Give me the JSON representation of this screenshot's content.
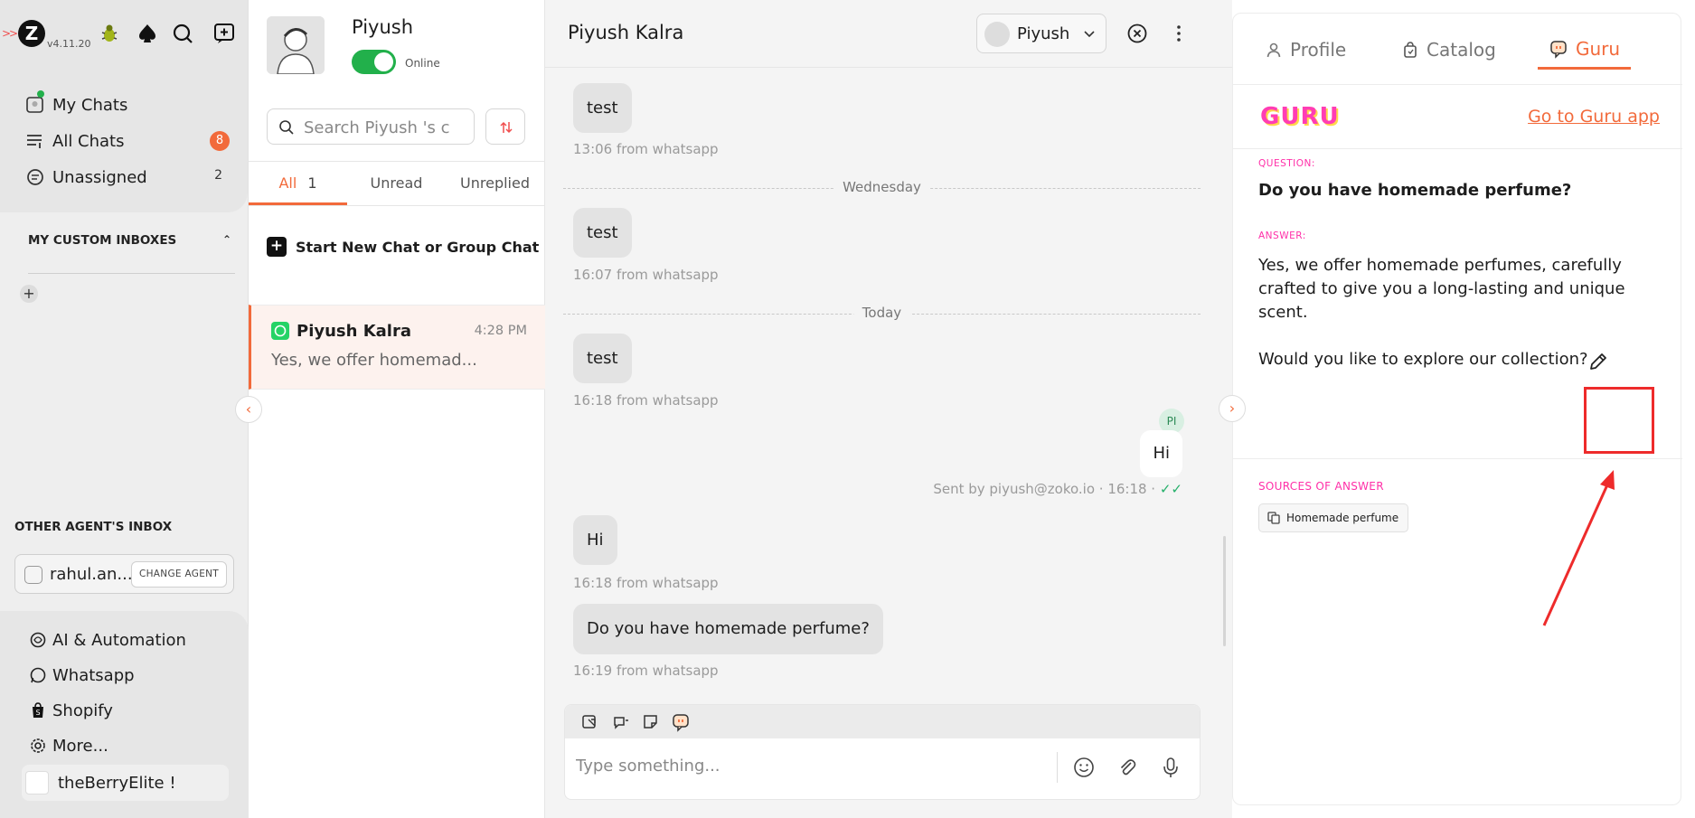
{
  "sidebar": {
    "version": "v4.11.20",
    "logo_letter": "Z",
    "nav": [
      {
        "label": "My Chats"
      },
      {
        "label": "All Chats",
        "badge": "8"
      },
      {
        "label": "Unassigned",
        "count": "2"
      }
    ],
    "custom_inboxes_title": "MY CUSTOM INBOXES",
    "other_agents_title": "OTHER AGENT'S INBOX",
    "agent_name": "rahul.an...",
    "change_agent_label": "CHANGE AGENT",
    "bottom_nav": [
      {
        "label": "AI & Automation"
      },
      {
        "label": "Whatsapp"
      },
      {
        "label": "Shopify"
      },
      {
        "label": "More..."
      }
    ],
    "store_name": "theBerryElite !"
  },
  "chatlist": {
    "user_name": "Piyush",
    "status": "Online",
    "search_placeholder": "Search Piyush 's c",
    "tabs": [
      {
        "label": "All",
        "count": "1"
      },
      {
        "label": "Unread"
      },
      {
        "label": "Unreplied"
      }
    ],
    "new_chat_label": "Start New Chat or Group Chat",
    "chats": [
      {
        "name": "Piyush Kalra",
        "time": "4:28 PM",
        "preview": "Yes, we offer homemad..."
      }
    ]
  },
  "conversation": {
    "title": "Piyush Kalra",
    "assignee": "Piyush",
    "messages": [
      {
        "text": "test",
        "meta": "13:06 from whatsapp"
      },
      {
        "divider": "Wednesday"
      },
      {
        "text": "test",
        "meta": "16:07 from whatsapp"
      },
      {
        "divider": "Today"
      },
      {
        "text": "test",
        "meta": "16:18 from whatsapp"
      },
      {
        "out_text": "Hi",
        "out_avatar": "PI",
        "out_meta": "Sent by piyush@zoko.io · 16:18 ·",
        "ticks": "✓✓"
      },
      {
        "text": "Hi",
        "meta": "16:18 from whatsapp"
      },
      {
        "text": "Do you have homemade perfume?",
        "meta": "16:19 from whatsapp"
      }
    ],
    "composer_placeholder": "Type something..."
  },
  "rightpanel": {
    "tabs": [
      {
        "label": "Profile",
        "icon": "person-icon"
      },
      {
        "label": "Catalog",
        "icon": "bag-icon"
      },
      {
        "label": "Guru",
        "icon": "guru-chat-icon",
        "active": true
      }
    ],
    "guru_logo": "GURU",
    "guru_link": "Go to Guru app",
    "question_label": "QUESTION:",
    "question": "Do you have homemade perfume?",
    "answer_label": "ANSWER:",
    "answer_p1": "Yes, we offer homemade perfumes, carefully crafted to give you a long-lasting and unique scent.",
    "answer_p2": "Would you like to explore our collection?",
    "sources_label": "SOURCES OF ANSWER",
    "source_chip": "Homemade perfume"
  },
  "colors": {
    "accent": "#f26a3b",
    "guru_pink": "#ff2fa8",
    "online_green": "#22b04b",
    "highlight_red": "#ee2b2b"
  }
}
